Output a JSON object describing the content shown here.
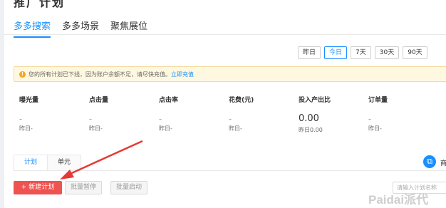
{
  "header": {
    "fragment": "推广计划"
  },
  "tabs": [
    {
      "label": "多多搜索"
    },
    {
      "label": "多多场景"
    },
    {
      "label": "聚焦展位"
    }
  ],
  "date_range": [
    "昨日",
    "今日",
    "7天",
    "30天",
    "90天"
  ],
  "notice": {
    "text": "您的所有计划已下线，因为账户余额不足，请尽快充值。",
    "link": "立即充值"
  },
  "metrics": [
    {
      "label": "曝光量",
      "value": "–",
      "prev": "昨日-"
    },
    {
      "label": "点击量",
      "value": "–",
      "prev": "昨日-"
    },
    {
      "label": "点击率",
      "value": "–",
      "prev": "昨日-"
    },
    {
      "label": "花费(元)",
      "value": "–",
      "prev": "昨日-"
    },
    {
      "label": "投入产出比",
      "value": "0.00",
      "prev": "昨日0.00"
    },
    {
      "label": "订单量",
      "value": "–",
      "prev": "昨日-"
    }
  ],
  "subtabs": [
    {
      "label": "计划"
    },
    {
      "label": "单元"
    }
  ],
  "toolbar": {
    "new_plan": "+ 新建计划",
    "batch_pause": "批量暂停",
    "batch_start": "批量启动",
    "search_placeholder": "请输入计划名称"
  },
  "right_cut_text": "商",
  "watermark": "Paidai派代",
  "colors": {
    "accent": "#1890ff",
    "danger": "#ef5350",
    "warning": "#f5a623",
    "arrow": "#e53935"
  }
}
